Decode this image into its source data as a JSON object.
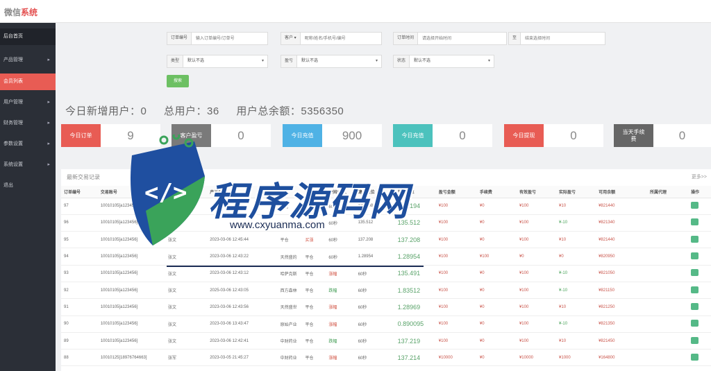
{
  "brand": {
    "part1": "微信",
    "part2": "系统"
  },
  "sidebar": {
    "items": [
      {
        "label": "后台首页",
        "chevron": false,
        "style": "dark"
      },
      {
        "label": "产品管理",
        "chevron": true,
        "style": ""
      },
      {
        "label": "会员列表",
        "chevron": false,
        "style": "active"
      },
      {
        "label": "用户管理",
        "chevron": true,
        "style": ""
      },
      {
        "label": "财务管理",
        "chevron": true,
        "style": ""
      },
      {
        "label": "参数设置",
        "chevron": true,
        "style": ""
      },
      {
        "label": "系统设置",
        "chevron": true,
        "style": ""
      },
      {
        "label": "退出",
        "chevron": false,
        "style": ""
      }
    ]
  },
  "filters": {
    "order_no_label": "订单编号",
    "order_no_placeholder": "输入订单编号/订单号",
    "user_select": "客户",
    "user_placeholder": "昵称/姓名/手机号/编号",
    "order_time_label": "订单时间",
    "start_placeholder": "请选择开始时间",
    "to_label": "至",
    "end_placeholder": "结束选择时间",
    "type_label": "类型",
    "type_value": "默认不选",
    "profit_label": "盈亏",
    "profit_value": "默认不选",
    "status_label": "状态",
    "status_value": "默认不选",
    "search_label": "搜索"
  },
  "summary": {
    "new_users": "今日新增用户：0",
    "total_users": "总用户：36",
    "total_balance": "用户总余额：5356350"
  },
  "cards": [
    {
      "label": "今日订单",
      "value": "9",
      "color": "#e85c54"
    },
    {
      "label": "客户盈亏",
      "value": "0",
      "color": "#7a7a7a"
    },
    {
      "label": "今日充值",
      "value": "900",
      "color": "#4fb2e5"
    },
    {
      "label": "今日充值",
      "value": "0",
      "color": "#4cc2bd"
    },
    {
      "label": "今日提现",
      "value": "0",
      "color": "#e85c54"
    },
    {
      "label": "当天手续费",
      "value": "0",
      "color": "#666666"
    }
  ],
  "panel": {
    "title": "最新交易记录",
    "more": "更多>>"
  },
  "table": {
    "headers": [
      "订单编号",
      "交易账号",
      "姓名",
      "产品信息",
      "状态",
      "方向",
      "时间/点数",
      "建仓点位",
      "平仓点位",
      "盈亏金额",
      "手续费",
      "有效盈亏",
      "实际盈亏",
      "可用余额",
      "所属代理",
      "操作"
    ],
    "rows": [
      [
        "97",
        "10010105[a123456]",
        "张文",
        "",
        "平仓",
        "买涨",
        "60秒",
        "137.208",
        "137.194",
        "¥100",
        "¥0",
        "¥100",
        "¥10",
        "¥821440",
        "",
        ""
      ],
      [
        "96",
        "10010105[a123456]",
        "张文",
        "",
        "平仓",
        "买涨",
        "60秒",
        "135.512",
        "135.512",
        "¥100",
        "¥0",
        "¥100",
        "¥-10",
        "¥821340",
        "",
        ""
      ],
      [
        "95",
        "10010105[a123456]",
        "张文",
        "2023-03-06 12:45:44",
        "平仓",
        "买涨",
        "60秒",
        "137.208",
        "137.208",
        "¥100",
        "¥0",
        "¥100",
        "¥10",
        "¥821440",
        "",
        ""
      ],
      [
        "94",
        "10010105[a123456]",
        "张文",
        "2023-03-06 12:43:22",
        "天然盛的",
        "平仓",
        "60秒",
        "1.28954",
        "1.28954",
        "¥100",
        "¥100",
        "¥0",
        "¥0",
        "¥820950",
        "",
        ""
      ],
      [
        "93",
        "10010105[a123456]",
        "张文",
        "2023-03-06 12:43:12",
        "哈萨克斯",
        "平仓",
        "涨幅",
        "60秒",
        "135.491",
        "¥100",
        "¥0",
        "¥100",
        "¥-10",
        "¥821050",
        "",
        ""
      ],
      [
        "92",
        "10010105[a123456]",
        "张文",
        "2025-03-06 12:43:05",
        "西方森林",
        "平仓",
        "跌幅",
        "60秒",
        "1.83512",
        "¥100",
        "¥0",
        "¥100",
        "¥-10",
        "¥821150",
        "",
        ""
      ],
      [
        "91",
        "10010105[a123456]",
        "张文",
        "2023-03-06 12:43:56",
        "天然盛世",
        "平仓",
        "涨幅",
        "60秒",
        "1.28969",
        "¥100",
        "¥0",
        "¥100",
        "¥10",
        "¥821250",
        "",
        ""
      ],
      [
        "90",
        "10010105[a123456]",
        "张文",
        "2023-03-06 13:43:47",
        "原始产业",
        "平仓",
        "涨幅",
        "60秒",
        "0.890095",
        "¥100",
        "¥0",
        "¥100",
        "¥-10",
        "¥821350",
        "",
        ""
      ],
      [
        "89",
        "10010105[a123456]",
        "张文",
        "2023-03-06 12:42:41",
        "中财药业",
        "平仓",
        "跌幅",
        "60秒",
        "137.219",
        "¥100",
        "¥0",
        "¥100",
        "¥10",
        "¥821450",
        "",
        ""
      ],
      [
        "88",
        "10010125[18976764663]",
        "张军",
        "2023-03-05 21:45:27",
        "中财药业",
        "平仓",
        "涨幅",
        "60秒",
        "137.214",
        "¥10000",
        "¥0",
        "¥10000",
        "¥1000",
        "¥164800",
        "",
        ""
      ]
    ]
  },
  "watermark": {
    "title": "程序源码网",
    "url": "www.cxyuanma.com"
  }
}
